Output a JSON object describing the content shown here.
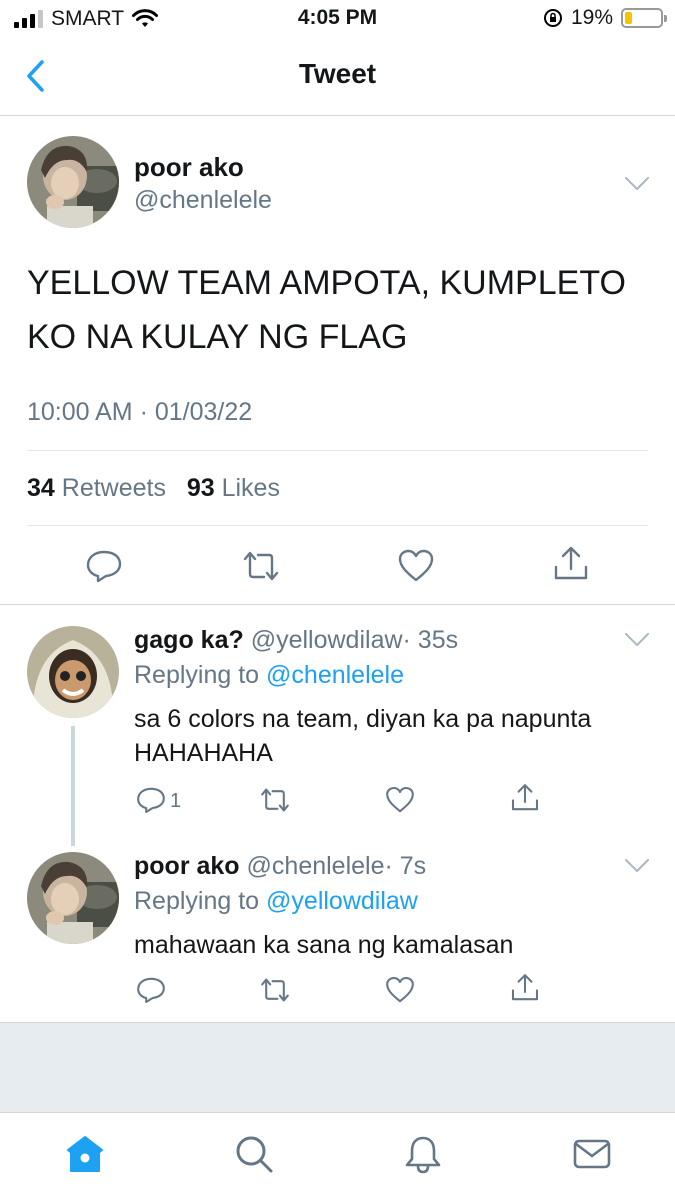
{
  "status_bar": {
    "carrier": "SMART",
    "time": "4:05 PM",
    "battery": "19%",
    "battery_level": 0.19
  },
  "nav": {
    "title": "Tweet"
  },
  "main_tweet": {
    "name": "poor ako",
    "handle": "@chenlelele",
    "text": "YELLOW TEAM AMPOTA, KUMPLETO KO NA KULAY NG FLAG",
    "timestamp": "10:00 AM · 01/03/22",
    "retweets_count": "34",
    "retweets_label": "Retweets",
    "likes_count": "93",
    "likes_label": "Likes"
  },
  "replies": [
    {
      "name": "gago ka?",
      "handle": "@yellowdilaw",
      "time": "· 35s",
      "replying_prefix": "Replying to",
      "replying_to": "@chenlelele",
      "text": "sa 6 colors na team, diyan ka pa napunta HAHAHAHA",
      "reply_count": "1"
    },
    {
      "name": "poor ako",
      "handle": "@chenlelele",
      "time": "· 7s",
      "replying_prefix": "Replying to",
      "replying_to": "@yellowdilaw",
      "text": "mahawaan ka sana ng kamalasan",
      "reply_count": ""
    }
  ],
  "icons": {
    "back": "chevron-left-icon",
    "reply": "reply-icon",
    "retweet": "retweet-icon",
    "like": "heart-icon",
    "share": "share-icon",
    "tabs": [
      "home-icon",
      "search-icon",
      "notifications-icon",
      "messages-icon"
    ]
  },
  "colors": {
    "accent": "#1da1f2",
    "secondary_text": "#657786",
    "battery_fill": "#f5c400"
  }
}
